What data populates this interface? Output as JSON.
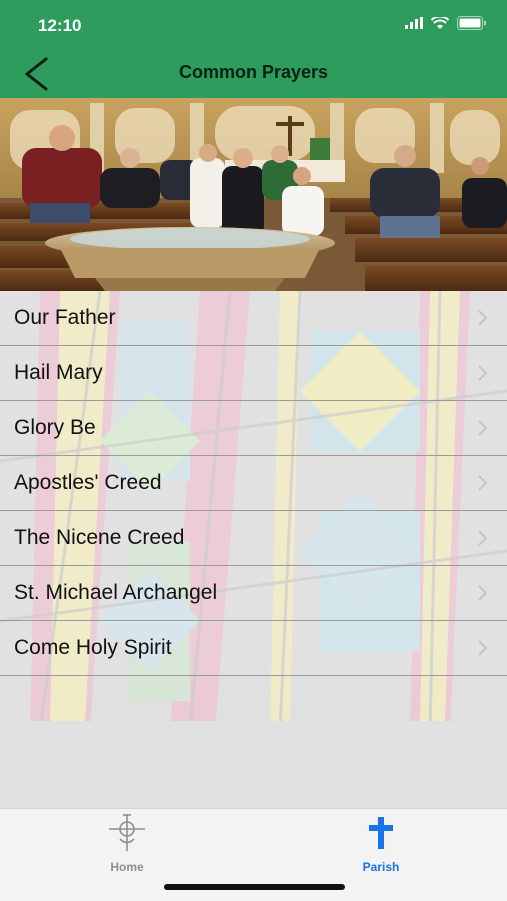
{
  "status_bar": {
    "time": "12:10"
  },
  "header": {
    "title": "Common Prayers"
  },
  "prayers": [
    {
      "label": "Our Father"
    },
    {
      "label": "Hail Mary"
    },
    {
      "label": "Glory Be"
    },
    {
      "label": "Apostles' Creed"
    },
    {
      "label": "The Nicene Creed"
    },
    {
      "label": "St. Michael Archangel"
    },
    {
      "label": "Come Holy Spirit"
    }
  ],
  "tabbar": {
    "home_label": "Home",
    "parish_label": "Parish",
    "active_color": "#1a73e8",
    "inactive_color": "#8e8e8e"
  },
  "colors": {
    "header_green": "#2e9c5c"
  }
}
